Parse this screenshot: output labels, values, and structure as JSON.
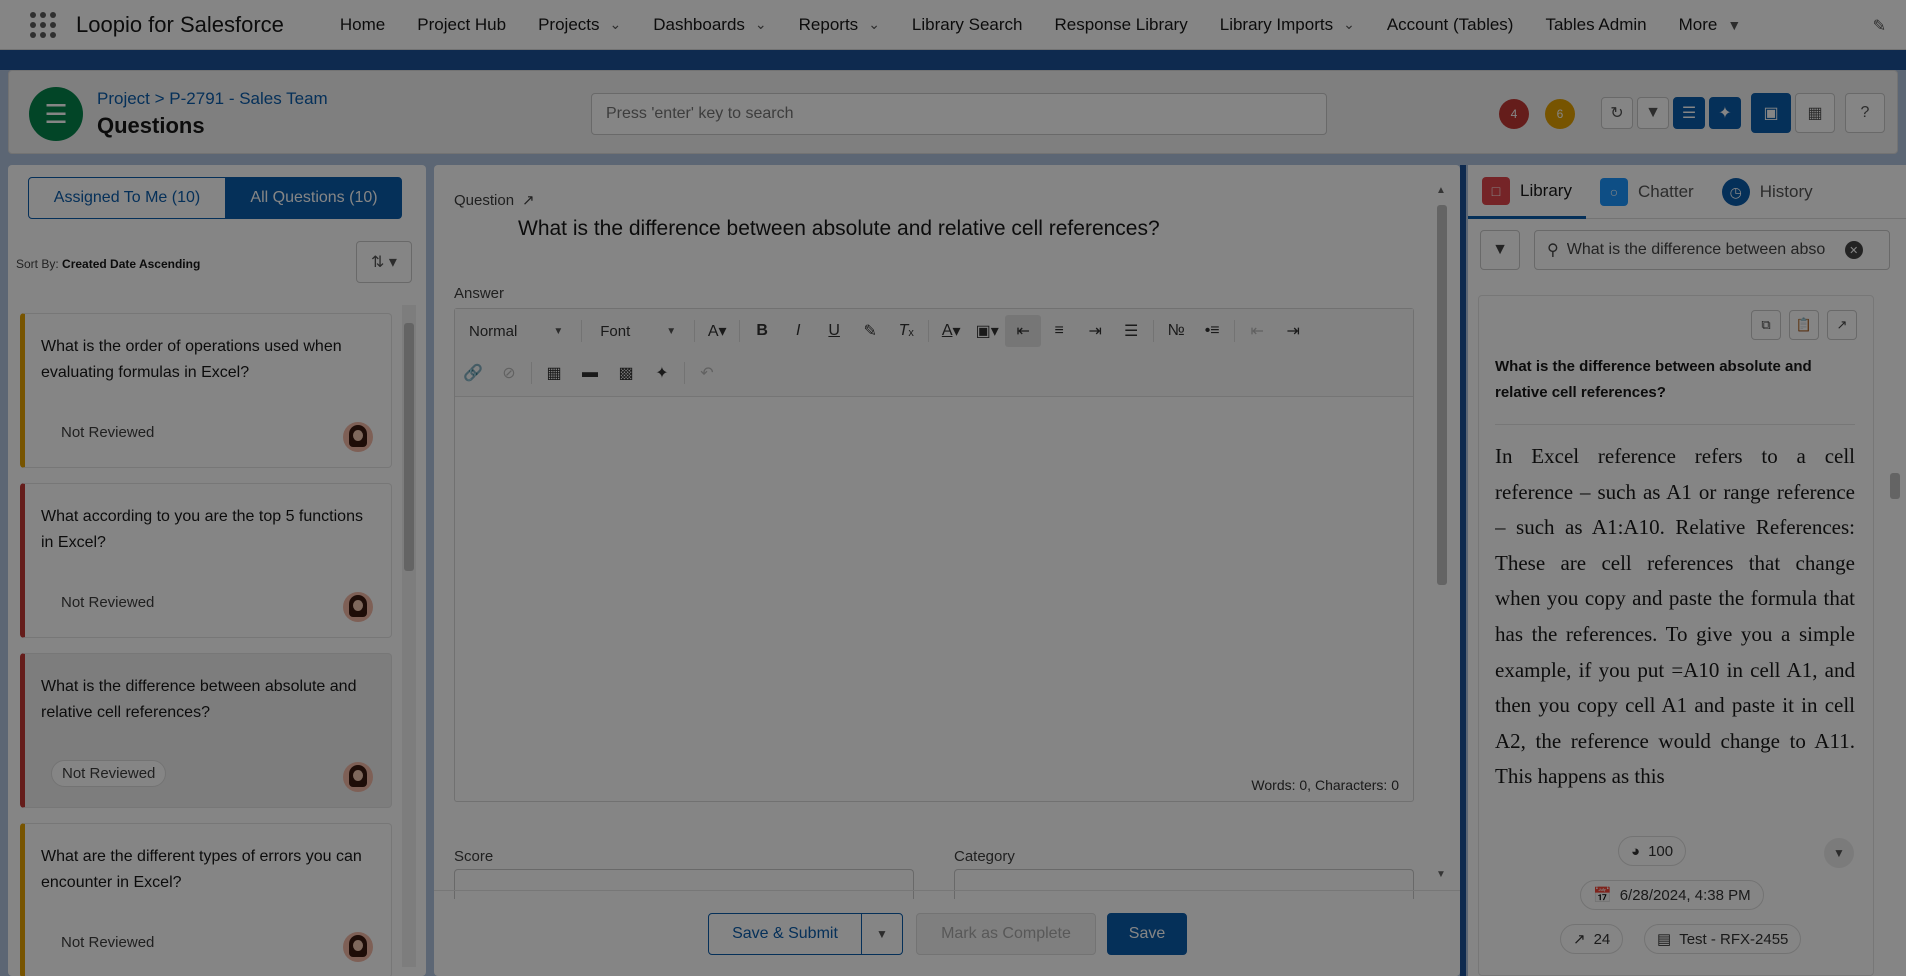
{
  "global_nav": {
    "app_name": "Loopio for Salesforce",
    "items": [
      {
        "label": "Home",
        "has_menu": false
      },
      {
        "label": "Project Hub",
        "has_menu": false
      },
      {
        "label": "Projects",
        "has_menu": true
      },
      {
        "label": "Dashboards",
        "has_menu": true
      },
      {
        "label": "Reports",
        "has_menu": true
      },
      {
        "label": "Library Search",
        "has_menu": false
      },
      {
        "label": "Response Library",
        "has_menu": false
      },
      {
        "label": "Library Imports",
        "has_menu": true
      },
      {
        "label": "Account (Tables)",
        "has_menu": false
      },
      {
        "label": "Tables Admin",
        "has_menu": false
      },
      {
        "label": "More",
        "has_menu": true
      }
    ]
  },
  "header": {
    "breadcrumb": "Project > P-2791 - Sales Team",
    "title": "Questions",
    "search_placeholder": "Press 'enter' key to search",
    "badge_red": "4",
    "badge_yellow": "6"
  },
  "left_panel": {
    "tab_assigned": "Assigned To Me (10)",
    "tab_all": "All Questions (10)",
    "sort_label": "Sort By:",
    "sort_value": "Created Date Ascending",
    "questions": [
      {
        "text": "What is the order of operations used when evaluating formulas in Excel?",
        "status": "Not Reviewed",
        "accent": "yellow",
        "selected": false
      },
      {
        "text": "What according to you are the top 5 functions in Excel?",
        "status": "Not Reviewed",
        "accent": "red",
        "selected": false
      },
      {
        "text": "What is the difference between absolute and relative cell references?",
        "status": "Not Reviewed",
        "accent": "red",
        "selected": true
      },
      {
        "text": "What are the different types of errors you can encounter in Excel?",
        "status": "Not Reviewed",
        "accent": "yellow",
        "selected": false
      }
    ]
  },
  "center_panel": {
    "question_label": "Question",
    "question_text": "What is the difference between absolute and relative cell references?",
    "answer_label": "Answer",
    "toolbar": {
      "style_select": "Normal",
      "font_select": "Font"
    },
    "counter": "Words: 0, Characters: 0",
    "score_label": "Score",
    "category_label": "Category",
    "buttons": {
      "save_submit": "Save & Submit",
      "mark_complete": "Mark as Complete",
      "save": "Save"
    }
  },
  "right_panel": {
    "tabs": [
      "Library",
      "Chatter",
      "History"
    ],
    "search_value": "What is the difference between abso",
    "card": {
      "question": "What is the difference between absolute and relative cell references?",
      "answer": "In Excel reference refers to a cell reference – such as A1 or range reference – such as A1:A10. Relative References: These are cell references that change when you copy and paste the formula that has the references. To give you a simple example, if you put =A10 in cell A1, and then you copy cell A1 and paste it in cell A2, the reference would change to A11. This happens as this",
      "score": "100",
      "date": "6/28/2024, 4:38 PM",
      "usage": "24",
      "source": "Test - RFX-2455"
    }
  },
  "colors": {
    "brand_blue": "#0b5cab",
    "band_blue": "#1b5297",
    "project_icon_green": "#04844b",
    "accent_yellow": "#e4a201",
    "accent_red": "#c23934"
  }
}
